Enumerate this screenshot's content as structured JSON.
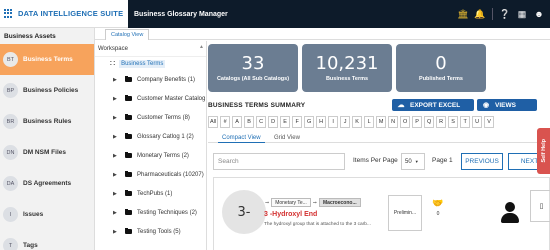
{
  "brand": {
    "title": "DATA INTELLIGENCE SUITE"
  },
  "app": {
    "title": "Business Glossary Manager"
  },
  "top_icons": [
    "bank-icon",
    "bell-icon",
    "help-icon",
    "reports-icon",
    "user-icon"
  ],
  "sidebar": {
    "header": "Business Assets",
    "items": [
      {
        "badge": "BT",
        "label": "Business Terms",
        "active": true
      },
      {
        "badge": "BP",
        "label": "Business Policies",
        "active": false
      },
      {
        "badge": "BR",
        "label": "Business Rules",
        "active": false
      },
      {
        "badge": "DN",
        "label": "DM NSM Files",
        "active": false
      },
      {
        "badge": "DA",
        "label": "DS Agreements",
        "active": false
      },
      {
        "badge": "I",
        "label": "Issues",
        "active": false
      },
      {
        "badge": "T",
        "label": "Tags",
        "active": false
      }
    ]
  },
  "catalog_tab": "Catalog View",
  "tree": {
    "title": "Workspace",
    "root": "Business Terms",
    "items": [
      "Company Benefits (1)",
      "Customer Master Catalog",
      "Customer Terms (8)",
      "Glossary Catlog 1 (2)",
      "Monetary Terms (2)",
      "Pharmaceuticals (10207)",
      "TechPubs (1)",
      "Testing Techniques (2)",
      "Testing Tools (5)"
    ]
  },
  "stats": [
    {
      "value": "33",
      "label": "Catalogs (All Sub Catalogs)"
    },
    {
      "value": "10,231",
      "label": "Business Terms"
    },
    {
      "value": "0",
      "label": "Published Terms"
    }
  ],
  "summary": {
    "title": "BUSINESS TERMS SUMMARY",
    "export_label": "EXPORT EXCEL",
    "views_label": "VIEWS"
  },
  "alphabet": [
    "All",
    "#",
    "A",
    "B",
    "C",
    "D",
    "E",
    "F",
    "G",
    "H",
    "I",
    "J",
    "K",
    "L",
    "M",
    "N",
    "O",
    "P",
    "Q",
    "R",
    "S",
    "T",
    "U",
    "V"
  ],
  "view_tabs": {
    "compact": "Compact View",
    "grid": "Grid View"
  },
  "toolbar": {
    "search_placeholder": "Search",
    "items_per_page_label": "Items Per Page",
    "items_per_page_value": "50",
    "page_label": "Page 1",
    "prev_label": "PREVIOUS",
    "next_label": "NEXT"
  },
  "card": {
    "avatar": "3-",
    "crumb_1": "Monetary Te...",
    "crumb_2": "Macroecono...",
    "name": "3 -Hydroxyl End",
    "description": "The hydroxyl group that is attached to the 3 carb...",
    "status": "Prelimin..."
  },
  "self_help": "Self Help",
  "colors": {
    "accent": "#1f5fa5",
    "active_sidebar": "#f7a35c",
    "stat_tile": "#6b7d92",
    "topbar": "#0d1b2a",
    "self_help": "#d9534f"
  }
}
